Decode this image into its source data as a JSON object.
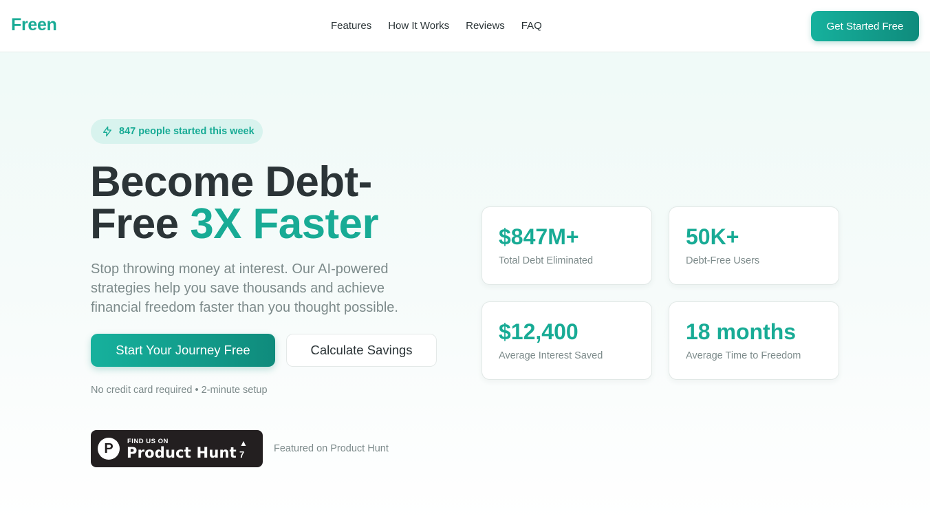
{
  "header": {
    "logo": "Freen",
    "nav": [
      "Features",
      "How It Works",
      "Reviews",
      "FAQ"
    ],
    "cta": "Get Started Free"
  },
  "hero": {
    "badge": "847 people started this week",
    "title_line1": "Become Debt-",
    "title_line2_plain": "Free",
    "title_line2_accent": "3X Faster",
    "subtitle": "Stop throwing money at interest. Our AI-powered strategies help you save thousands and achieve financial freedom faster than you thought possible.",
    "primary_button": "Start Your Journey Free",
    "secondary_button": "Calculate Savings",
    "note": "No credit card required • 2-minute setup"
  },
  "product_hunt": {
    "small_text": "FIND US ON",
    "big_text": "Product Hunt",
    "logo_letter": "P",
    "arrow": "▲",
    "upvotes": "7",
    "caption": "Featured on Product Hunt"
  },
  "stats": [
    {
      "value": "$847M+",
      "label": "Total Debt Eliminated"
    },
    {
      "value": "50K+",
      "label": "Debt-Free Users"
    },
    {
      "value": "$12,400",
      "label": "Average Interest Saved"
    },
    {
      "value": "18 months",
      "label": "Average Time to Freedom"
    }
  ],
  "colors": {
    "accent": "#18ab95",
    "accent_dark": "#0f8b7c",
    "text": "#2b3437",
    "muted": "#7c8a8a"
  },
  "icons": {
    "badge_icon": "lightning-icon"
  }
}
